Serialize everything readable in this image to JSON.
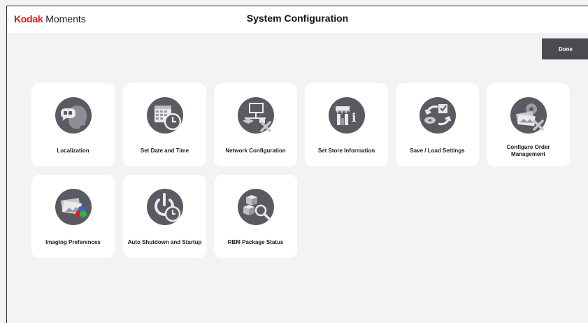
{
  "header": {
    "brand_logo": "Kodak",
    "brand_product": "Moments",
    "title": "System Configuration"
  },
  "toolbar": {
    "done_label": "Done"
  },
  "tiles": [
    {
      "label": "Localization",
      "icon": "speech-bubble-head-icon"
    },
    {
      "label": "Set Date and Time",
      "icon": "calendar-clock-icon"
    },
    {
      "label": "Network Configuration",
      "icon": "network-monitor-tools-icon"
    },
    {
      "label": "Set Store Information",
      "icon": "storefront-info-icon"
    },
    {
      "label": "Save / Load Settings",
      "icon": "disk-sync-checkbox-icon"
    },
    {
      "label": "Configure Order Management",
      "icon": "photos-gear-tools-icon"
    },
    {
      "label": "Imaging Preferences",
      "icon": "photos-color-circles-icon"
    },
    {
      "label": "Auto Shutdown and Startup",
      "icon": "power-clock-icon"
    },
    {
      "label": "RBM Package Status",
      "icon": "boxes-magnifier-icon"
    }
  ],
  "colors": {
    "brand_red": "#d21d1d",
    "icon_circle": "#5a5a62",
    "done_button": "#4a4a50",
    "background": "#f3f3f3"
  }
}
